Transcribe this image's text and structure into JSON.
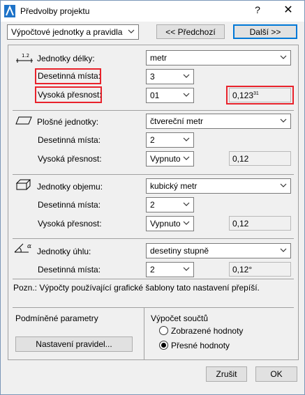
{
  "window": {
    "title": "Předvolby projektu",
    "help_glyph": "?",
    "close_glyph": "✕"
  },
  "toolbar": {
    "section_select": "Výpočtové jednotky a pravidla",
    "prev_label": "<< Předchozí",
    "next_label": "Další >>"
  },
  "length": {
    "label": "Jednotky délky:",
    "unit_value": "metr",
    "decimals_label": "Desetinná místa:",
    "decimals_value": "3",
    "precision_label": "Vysoká přesnost:",
    "precision_value": "01",
    "preview": "0,123",
    "preview_sup": "31",
    "icon_text": "1.2"
  },
  "area": {
    "label": "Plošné jednotky:",
    "unit_value": "čtvereční metr",
    "decimals_label": "Desetinná místa:",
    "decimals_value": "2",
    "precision_label": "Vysoká přesnost:",
    "precision_value": "Vypnuto",
    "preview": "0,12"
  },
  "volume": {
    "label": "Jednotky objemu:",
    "unit_value": "kubický metr",
    "decimals_label": "Desetinná místa:",
    "decimals_value": "2",
    "precision_label": "Vysoká přesnost:",
    "precision_value": "Vypnuto",
    "preview": "0,12"
  },
  "angle": {
    "label": "Jednotky úhlu:",
    "unit_value": "desetiny stupně",
    "decimals_label": "Desetinná místa:",
    "decimals_value": "2",
    "preview": "0,12°",
    "icon_text": "α"
  },
  "note": "Pozn.: Výpočty používající grafické šablony tato nastavení přepíší.",
  "conditional": {
    "label": "Podmíněné parametry",
    "button": "Nastavení pravidel..."
  },
  "totals": {
    "label": "Výpočet součtů",
    "option_displayed": "Zobrazené hodnoty",
    "option_exact": "Přesné hodnoty",
    "selected": "Přesné hodnoty"
  },
  "footer": {
    "cancel": "Zrušit",
    "ok": "OK"
  },
  "colors": {
    "highlight": "#e8222b",
    "primary_border": "#0078d7",
    "background": "#f0f0f0"
  }
}
